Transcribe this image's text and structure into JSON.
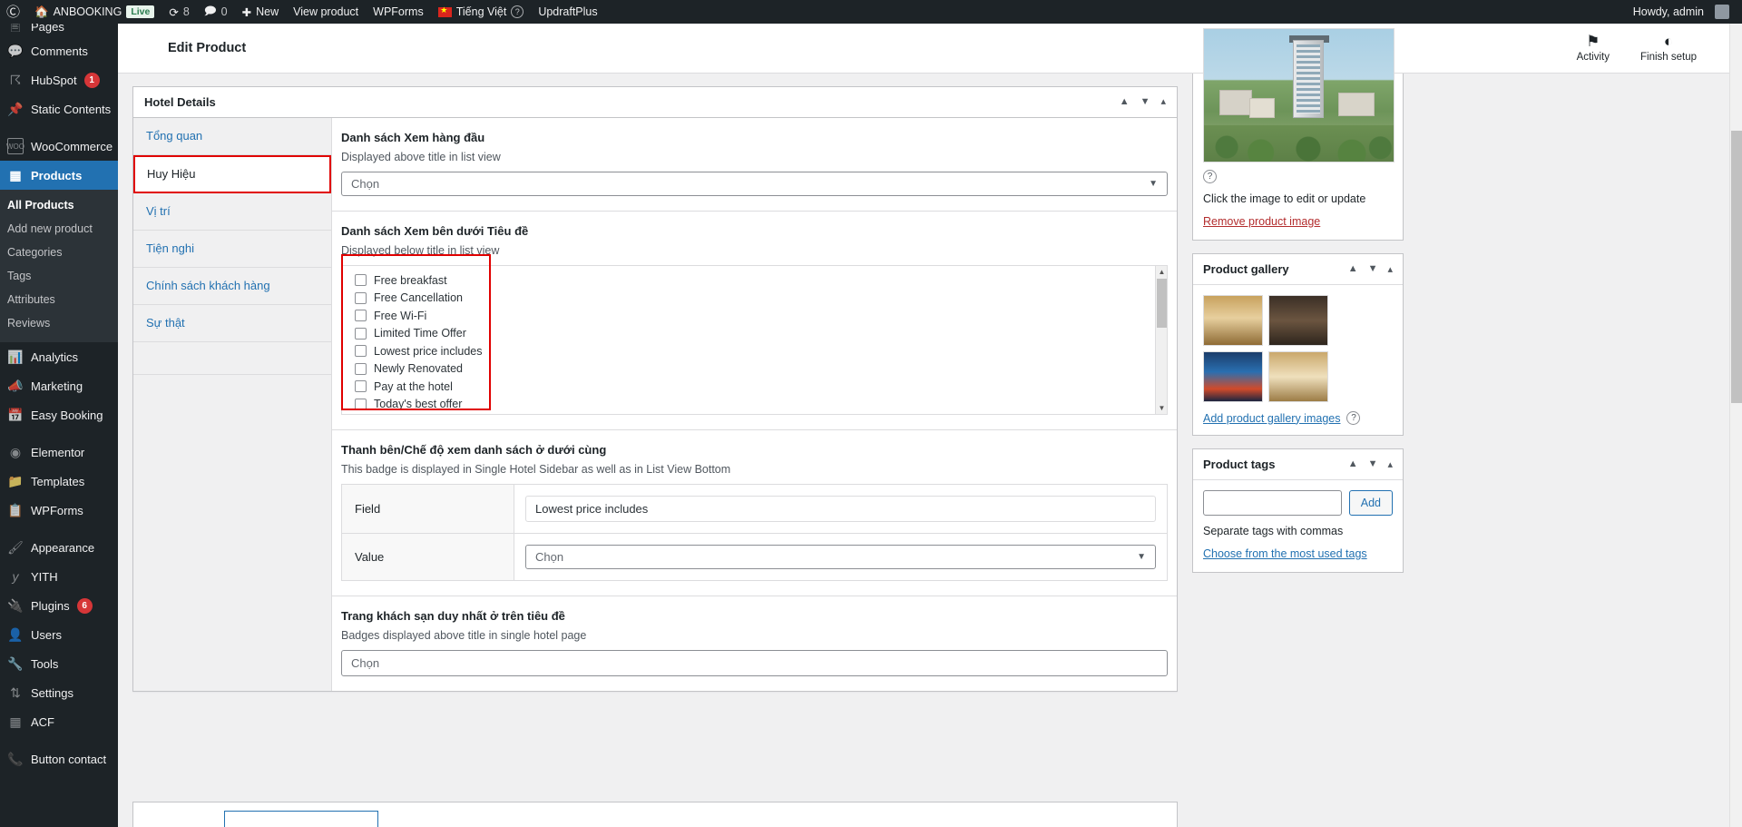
{
  "adminbar": {
    "logo_icon": "wordpress-logo-icon",
    "site_icon": "home-icon",
    "site_name": "ANBOOKING",
    "live_badge": "Live",
    "updates_icon": "updates-icon",
    "updates_count": "8",
    "comments_icon": "comment-bubble-icon",
    "comments_count": "0",
    "new_icon": "plus-icon",
    "new_label": "New",
    "view_product": "View product",
    "wpforms": "WPForms",
    "language": "Tiếng Việt",
    "language_flag_icon": "vietnam-flag-icon",
    "help_icon": "question-mark-icon",
    "updraftplus": "UpdraftPlus",
    "howdy": "Howdy, admin",
    "avatar_icon": "user-avatar-icon"
  },
  "sidebar": {
    "items": [
      {
        "label": "Pages",
        "icon": "page-icon",
        "state": "clipped"
      },
      {
        "label": "Comments",
        "icon": "comment-icon"
      },
      {
        "label": "HubSpot",
        "icon": "hubspot-icon",
        "bubble": "1"
      },
      {
        "label": "Static Contents",
        "icon": "pin-icon"
      },
      {
        "label": "WooCommerce",
        "icon": "woo-icon"
      },
      {
        "label": "Products",
        "icon": "products-icon",
        "current": true
      },
      {
        "label": "Analytics",
        "icon": "bar-chart-icon"
      },
      {
        "label": "Marketing",
        "icon": "megaphone-icon"
      },
      {
        "label": "Easy Booking",
        "icon": "calendar-icon"
      },
      {
        "label": "Elementor",
        "icon": "elementor-icon"
      },
      {
        "label": "Templates",
        "icon": "folder-icon"
      },
      {
        "label": "WPForms",
        "icon": "wpforms-icon"
      },
      {
        "label": "Appearance",
        "icon": "paintbrush-icon"
      },
      {
        "label": "YITH",
        "icon": "yith-icon"
      },
      {
        "label": "Plugins",
        "icon": "plug-icon",
        "bubble": "6"
      },
      {
        "label": "Users",
        "icon": "user-icon"
      },
      {
        "label": "Tools",
        "icon": "wrench-icon"
      },
      {
        "label": "Settings",
        "icon": "sliders-icon"
      },
      {
        "label": "ACF",
        "icon": "acf-icon"
      },
      {
        "label": "Button contact",
        "icon": "phone-icon"
      }
    ],
    "products_submenu": [
      {
        "label": "All Products",
        "current": true
      },
      {
        "label": "Add new product"
      },
      {
        "label": "Categories"
      },
      {
        "label": "Tags"
      },
      {
        "label": "Attributes"
      },
      {
        "label": "Reviews"
      }
    ]
  },
  "page": {
    "title": "Edit Product",
    "actions": [
      {
        "label": "Activity",
        "icon": "flag-icon"
      },
      {
        "label": "Finish setup",
        "icon": "half-circle-icon"
      }
    ]
  },
  "hotel_details": {
    "panel_title": "Hotel Details",
    "panel_controls": [
      "chevron-up-icon",
      "chevron-down-icon",
      "toggle-icon"
    ],
    "tabs": [
      {
        "label": "Tổng quan"
      },
      {
        "label": "Huy Hiệu",
        "active": true
      },
      {
        "label": "Vị trí"
      },
      {
        "label": "Tiện nghi"
      },
      {
        "label": "Chính sách khách hàng"
      },
      {
        "label": "Sự thật"
      }
    ],
    "fields": {
      "top_list": {
        "label": "Danh sách Xem hàng đầu",
        "hint": "Displayed above title in list view",
        "placeholder": "Chọn"
      },
      "below_title_list": {
        "label": "Danh sách Xem bên dưới Tiêu đề",
        "hint": "Displayed below title in list view",
        "options": [
          "Free breakfast",
          "Free Cancellation",
          "Free Wi-Fi",
          "Limited Time Offer",
          "Lowest price includes",
          "Newly Renovated",
          "Pay at the hotel",
          "Today's best offer"
        ]
      },
      "sidebar_bottom": {
        "label": "Thanh bên/Chế độ xem danh sách ở dưới cùng",
        "hint": "This badge is displayed in Single Hotel Sidebar as well as in List View Bottom",
        "rows": [
          {
            "name": "Field",
            "value": "Lowest price includes",
            "type": "text"
          },
          {
            "name": "Value",
            "value": "Chọn",
            "type": "select"
          }
        ]
      },
      "single_hotel_above_title": {
        "label": "Trang khách sạn duy nhất ở trên tiêu đề",
        "hint": "Badges displayed above title in single hotel page",
        "placeholder": "Chọn"
      }
    }
  },
  "side_panels": {
    "featured_image": {
      "help_icon": "question-mark-icon",
      "caption": "Click the image to edit or update",
      "remove_link": "Remove product image"
    },
    "product_gallery": {
      "title": "Product gallery",
      "controls": [
        "chevron-up-icon",
        "chevron-down-icon",
        "toggle-icon"
      ],
      "add_link": "Add product gallery images",
      "help_icon": "question-mark-icon",
      "thumb_count": 4
    },
    "product_tags": {
      "title": "Product tags",
      "controls": [
        "chevron-up-icon",
        "chevron-down-icon",
        "toggle-icon"
      ],
      "input_value": "",
      "add_button": "Add",
      "hint": "Separate tags with commas",
      "choose_link": "Choose from the most used tags"
    }
  },
  "colors": {
    "admin_dark": "#1d2327",
    "accent_blue": "#2271b1",
    "highlight_red": "#e00000",
    "danger_red": "#b32d2e",
    "bubble_red": "#d63638"
  }
}
